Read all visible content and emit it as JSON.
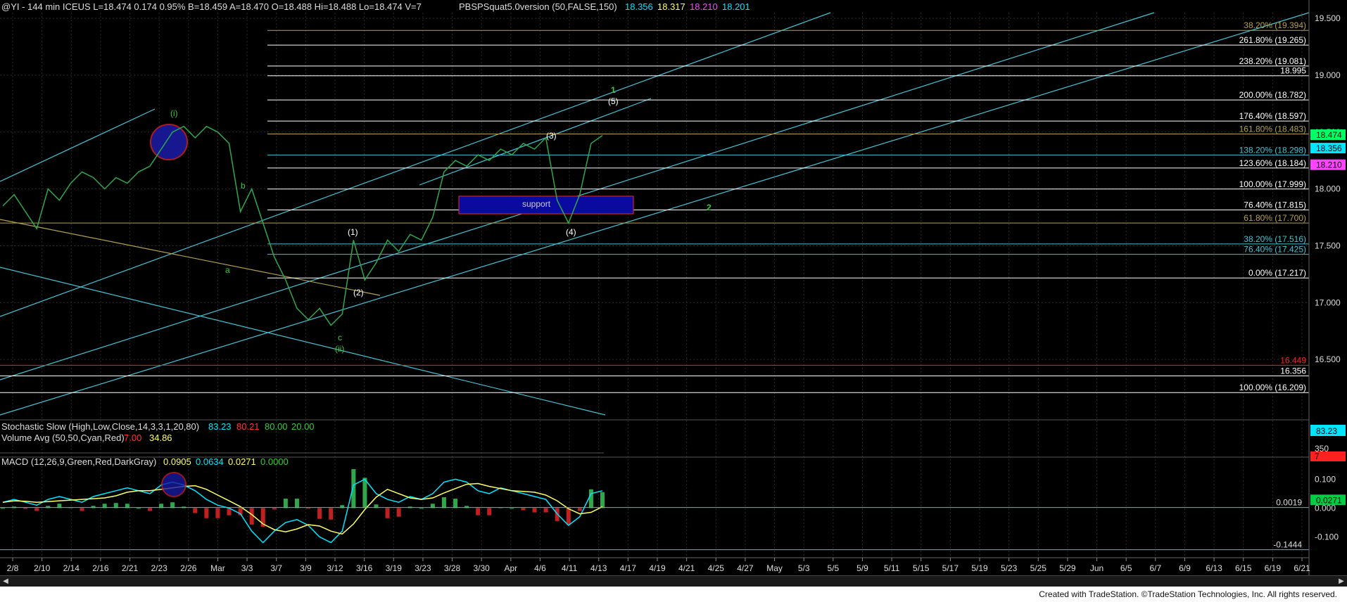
{
  "header": {
    "symbol_text": "@YI - 144 min  ICEUS  L=18.474  0.174  0.95%  B=18.459  A=18.470  O=18.488  Hi=18.488  Lo=18.474  V=7",
    "indicator_name": "PBSPSquat5.0version (50,FALSE,150)",
    "indicator_values": [
      {
        "text": "18.356",
        "color": "#00e5ff"
      },
      {
        "text": "18.317",
        "color": "#ffff66"
      },
      {
        "text": "18.210",
        "color": "#ff44ff"
      },
      {
        "text": "18.201",
        "color": "#00e5ff"
      }
    ]
  },
  "colors": {
    "grid": "#2a2a2a",
    "channel": "#46c3d6",
    "fib_white": "#ffffff",
    "fib_gold": "#b4a050",
    "price_green": "#2ea84b",
    "wave_green": "#33cc33",
    "support_box": "#0a0aa0",
    "red_line": "#ff2020",
    "macd_line": "#00e5ff",
    "signal_line": "#ffff66"
  },
  "chart_data": [
    {
      "type": "line",
      "title": "@YI - 144 min",
      "y_axis_ticks": [
        "19.500",
        "19.000",
        "18.500",
        "18.000",
        "17.500",
        "17.000",
        "16.500"
      ],
      "ylim": [
        16.0,
        19.55
      ],
      "x_tick_labels": [
        "2/8",
        "2/10",
        "2/14",
        "2/16",
        "2/21",
        "2/23",
        "2/26",
        "Mar",
        "3/3",
        "3/7",
        "3/9",
        "3/12",
        "3/16",
        "3/19",
        "3/23",
        "3/28",
        "3/30",
        "Apr",
        "4/6",
        "4/11",
        "4/13",
        "4/17",
        "4/19",
        "4/21",
        "4/25",
        "4/27",
        "May",
        "5/3",
        "5/5",
        "5/9",
        "5/11",
        "5/15",
        "5/17",
        "5/19",
        "5/23",
        "5/25",
        "5/29",
        "Jun",
        "6/5",
        "6/7",
        "6/9",
        "6/13",
        "6/15",
        "6/19",
        "6/21"
      ],
      "price_series": [
        17.85,
        17.95,
        17.8,
        17.65,
        18.0,
        17.9,
        18.05,
        18.15,
        18.1,
        18.0,
        18.1,
        18.05,
        18.15,
        18.2,
        18.35,
        18.5,
        18.55,
        18.45,
        18.55,
        18.5,
        18.4,
        17.8,
        18.0,
        17.7,
        17.4,
        17.2,
        16.95,
        16.85,
        16.95,
        16.8,
        16.9,
        17.55,
        17.2,
        17.35,
        17.55,
        17.45,
        17.6,
        17.55,
        17.75,
        18.15,
        18.25,
        18.2,
        18.3,
        18.25,
        18.35,
        18.3,
        18.4,
        18.35,
        18.45,
        17.9,
        17.7,
        17.95,
        18.4,
        18.47
      ],
      "price_labels": [
        {
          "text": "18.474",
          "value": 18.474,
          "bg": "#00ff66",
          "fg": "#000000"
        },
        {
          "text": "18.356",
          "value": 18.356,
          "bg": "#00e5ff",
          "fg": "#000000"
        },
        {
          "text": "18.210",
          "value": 18.21,
          "bg": "#ff44ff",
          "fg": "#000000"
        }
      ],
      "fib_levels": [
        {
          "text": "38.20% (19.394)",
          "value": 19.394,
          "color": "#b4a050"
        },
        {
          "text": "261.80% (19.265)",
          "value": 19.265,
          "color": "#ffffff"
        },
        {
          "text": "238.20% (19.081)",
          "value": 19.081,
          "color": "#ffffff"
        },
        {
          "text": "18.995",
          "value": 18.995,
          "color": "#ffffff"
        },
        {
          "text": "200.00% (18.782)",
          "value": 18.782,
          "color": "#ffffff"
        },
        {
          "text": "176.40% (18.597)",
          "value": 18.597,
          "color": "#ffffff"
        },
        {
          "text": "161.80% (18.483)",
          "value": 18.483,
          "color": "#b4a050"
        },
        {
          "text": "138.20% (18.298)",
          "value": 18.298,
          "color": "#46c3d6"
        },
        {
          "text": "123.60% (18.184)",
          "value": 18.184,
          "color": "#ffffff"
        },
        {
          "text": "100.00% (17.999)",
          "value": 17.999,
          "color": "#ffffff"
        },
        {
          "text": "76.40% (17.815)",
          "value": 17.815,
          "color": "#ffffff"
        },
        {
          "text": "61.80% (17.700)",
          "value": 17.7,
          "color": "#b4a050"
        },
        {
          "text": "38.20% (17.516)",
          "value": 17.516,
          "color": "#46c3d6"
        },
        {
          "text": "76.40% (17.425)",
          "value": 17.425,
          "color": "#46c3d6"
        },
        {
          "text": "0.00% (17.217)",
          "value": 17.217,
          "color": "#ffffff"
        },
        {
          "text": "16.449",
          "value": 16.449,
          "color": "#ff2020"
        },
        {
          "text": "16.356",
          "value": 16.356,
          "color": "#ffffff"
        },
        {
          "text": "100.00% (16.209)",
          "value": 16.209,
          "color": "#ffffff"
        }
      ],
      "annotations": [
        "(i)",
        "(ii)",
        "a",
        "b",
        "c",
        "(1)",
        "(2)",
        "(3)",
        "(4)",
        "(5)",
        "1",
        "2",
        "support"
      ]
    },
    {
      "type": "line",
      "title": "Stochastic Slow (High,Low,Close,14,3,3,1,20,80)",
      "values": [
        {
          "text": "83.23",
          "color": "#00e5ff"
        },
        {
          "text": "80.21",
          "color": "#ff3333"
        },
        {
          "text": "80.00",
          "color": "#33cc33"
        },
        {
          "text": "20.00",
          "color": "#33cc33"
        }
      ],
      "axis_label": "83.23"
    },
    {
      "type": "bar",
      "title": "Volume Avg (50,50,Cyan,Red)",
      "values": [
        {
          "text": "7.00",
          "color": "#ff3333"
        },
        {
          "text": "34.86",
          "color": "#ffff66"
        }
      ],
      "axis_labels": [
        "350",
        "7"
      ]
    },
    {
      "type": "line",
      "title": "MACD (12,26,9,Green,Red,DarkGray)",
      "values": [
        {
          "text": "0.0905",
          "color": "#ffff66"
        },
        {
          "text": "0.0634",
          "color": "#00e5ff"
        },
        {
          "text": "0.0271",
          "color": "#ffff66"
        },
        {
          "text": "0.0000",
          "color": "#33cc33"
        }
      ],
      "y_axis_ticks": [
        "0.100",
        "0.000",
        "-0.100"
      ],
      "ylim": [
        -0.16,
        0.14
      ],
      "level_labels": [
        {
          "text": "0.0019",
          "value": 0.0019
        },
        {
          "text": "-0.1444",
          "value": -0.1444
        }
      ],
      "current_label": {
        "text": "0.0271",
        "value": 0.0271
      },
      "macd_series": [
        0.02,
        0.03,
        0.02,
        0.01,
        0.03,
        0.04,
        0.03,
        0.02,
        0.04,
        0.05,
        0.06,
        0.07,
        0.06,
        0.05,
        0.08,
        0.09,
        0.08,
        0.06,
        0.03,
        0.01,
        0.0,
        -0.02,
        -0.08,
        -0.12,
        -0.08,
        -0.05,
        -0.04,
        -0.06,
        -0.1,
        -0.12,
        -0.08,
        0.08,
        0.1,
        0.05,
        0.03,
        0.02,
        0.04,
        0.03,
        0.05,
        0.09,
        0.1,
        0.09,
        0.06,
        0.05,
        0.07,
        0.06,
        0.05,
        0.04,
        0.03,
        -0.02,
        -0.06,
        -0.03,
        0.05,
        0.06
      ]
    }
  ],
  "footer": {
    "credit": "Created with TradeStation. ©TradeStation Technologies, Inc. All rights reserved."
  }
}
